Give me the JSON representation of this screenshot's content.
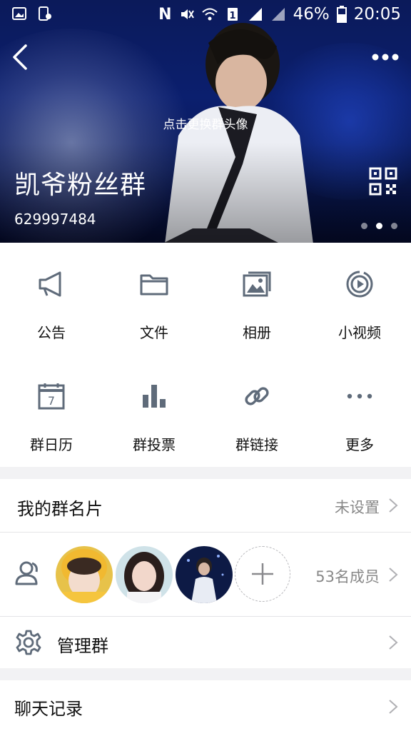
{
  "status_bar": {
    "battery": "46%",
    "time": "20:05"
  },
  "header": {
    "change_avatar_hint": "点击更换群头像",
    "group_name": "凯爷粉丝群",
    "group_id": "629997484"
  },
  "actions": [
    {
      "label": "公告",
      "icon": "megaphone-icon"
    },
    {
      "label": "文件",
      "icon": "folder-icon"
    },
    {
      "label": "相册",
      "icon": "photo-album-icon"
    },
    {
      "label": "小视频",
      "icon": "video-play-icon"
    },
    {
      "label": "群日历",
      "icon": "calendar-icon"
    },
    {
      "label": "群投票",
      "icon": "bar-chart-icon"
    },
    {
      "label": "群链接",
      "icon": "link-icon"
    },
    {
      "label": "更多",
      "icon": "more-dots-icon"
    }
  ],
  "group_card": {
    "label": "我的群名片",
    "value": "未设置"
  },
  "members": {
    "count_label": "53名成员"
  },
  "manage": {
    "label": "管理群"
  },
  "chat_history": {
    "label": "聊天记录"
  },
  "colors": {
    "icon_gray": "#5f6b7a",
    "text_gray": "#888888",
    "background": "#f2f2f4"
  }
}
